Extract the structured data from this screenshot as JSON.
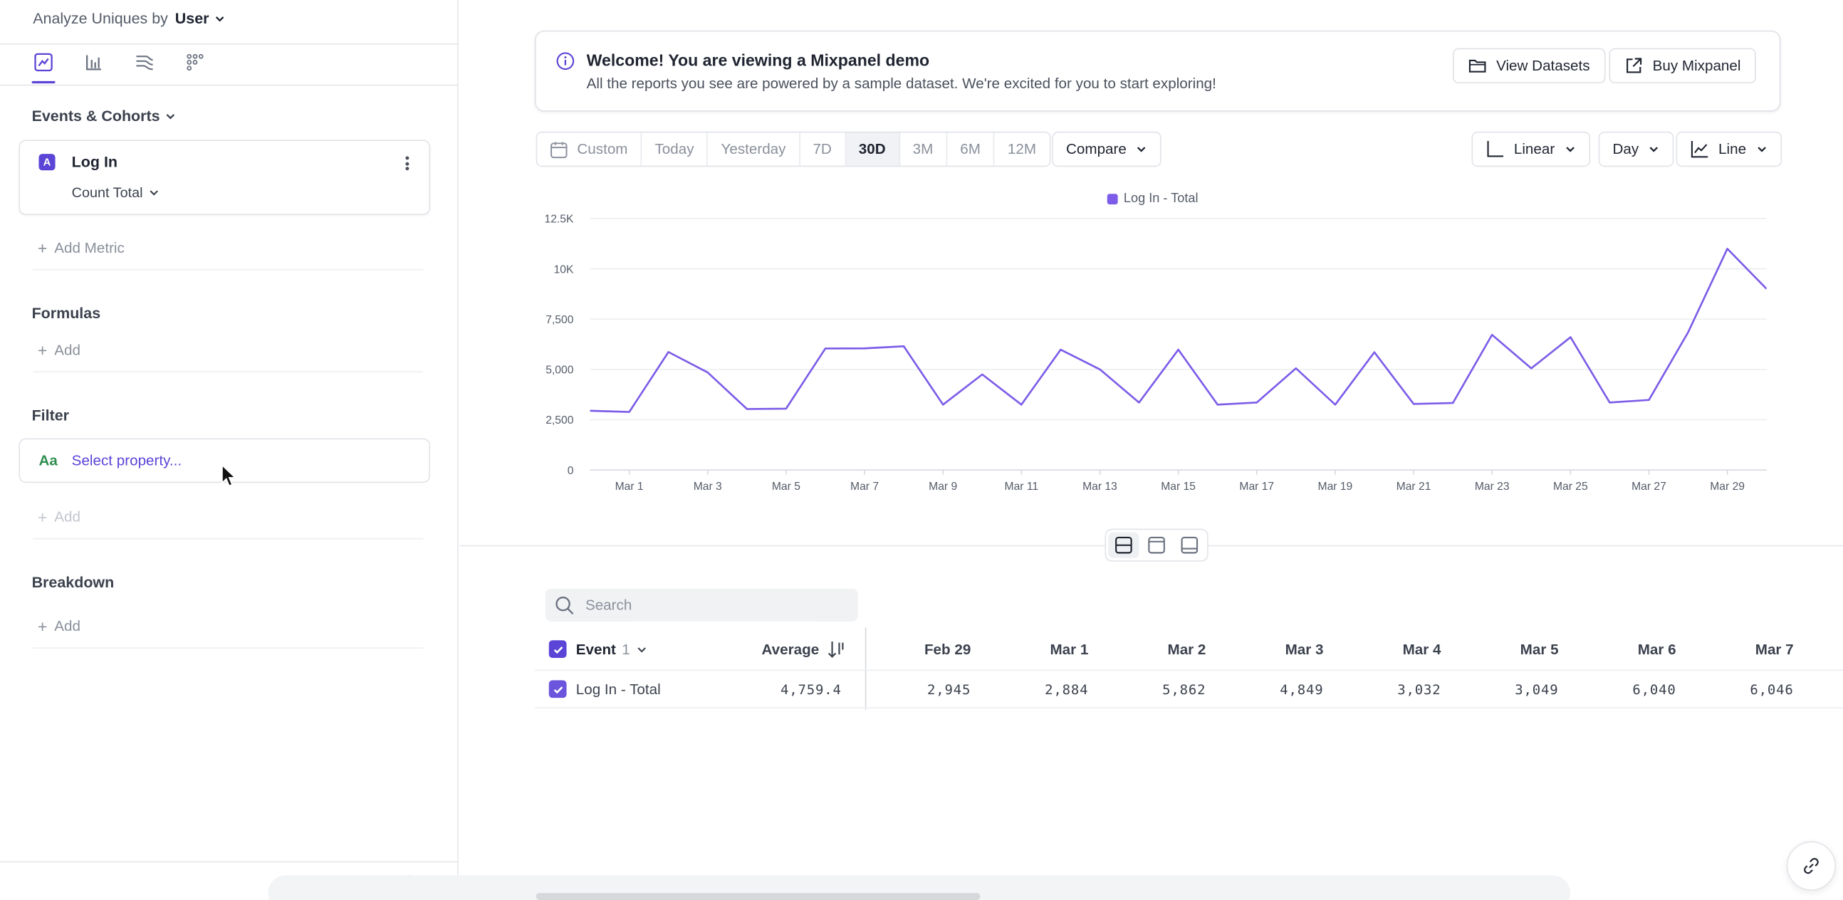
{
  "sidebar": {
    "analyze_label": "Analyze Uniques by",
    "analyze_value": "User",
    "view_tabs": [
      "insights-line-icon",
      "insights-bar-icon",
      "funnels-icon",
      "retention-grid-icon"
    ],
    "events_title": "Events & Cohorts",
    "metric": {
      "letter": "A",
      "name": "Log In",
      "measure": "Count Total"
    },
    "add_metric": "Add Metric",
    "formulas_title": "Formulas",
    "formulas_add": "Add",
    "filter_title": "Filter",
    "filter_type": "Aa",
    "filter_placeholder": "Select property...",
    "filter_add": "Add",
    "breakdown_title": "Breakdown",
    "breakdown_add": "Add"
  },
  "banner": {
    "title": "Welcome! You are viewing a Mixpanel demo",
    "subtitle": "All the reports you see are powered by a sample dataset. We're excited for you to start exploring!",
    "view_datasets": "View Datasets",
    "buy": "Buy Mixpanel"
  },
  "toolbar": {
    "ranges": [
      "Custom",
      "Today",
      "Yesterday",
      "7D",
      "30D",
      "3M",
      "6M",
      "12M"
    ],
    "active_range": "30D",
    "compare": "Compare",
    "scale": "Linear",
    "interval": "Day",
    "chart_type": "Line"
  },
  "chart_data": {
    "type": "line",
    "title": "",
    "xlabel": "",
    "ylabel": "",
    "ylim": [
      0,
      12500
    ],
    "yticks": [
      "0",
      "2,500",
      "5,000",
      "7,500",
      "10K",
      "12.5K"
    ],
    "x": [
      "Feb 29",
      "Mar 1",
      "Mar 2",
      "Mar 3",
      "Mar 4",
      "Mar 5",
      "Mar 6",
      "Mar 7",
      "Mar 8",
      "Mar 9",
      "Mar 10",
      "Mar 11",
      "Mar 12",
      "Mar 13",
      "Mar 14",
      "Mar 15",
      "Mar 16",
      "Mar 17",
      "Mar 18",
      "Mar 19",
      "Mar 20",
      "Mar 21",
      "Mar 22",
      "Mar 23",
      "Mar 24",
      "Mar 25",
      "Mar 26",
      "Mar 27",
      "Mar 28",
      "Mar 29",
      "Mar 30"
    ],
    "xtick_labels": [
      "Mar 1",
      "Mar 3",
      "Mar 5",
      "Mar 7",
      "Mar 9",
      "Mar 11",
      "Mar 13",
      "Mar 15",
      "Mar 17",
      "Mar 19",
      "Mar 21",
      "Mar 23",
      "Mar 25",
      "Mar 27",
      "Mar 29"
    ],
    "series": [
      {
        "name": "Log In - Total",
        "color": "#7c5ce8",
        "values": [
          2945,
          2884,
          5862,
          4849,
          3032,
          3049,
          6040,
          6046,
          6150,
          3250,
          4750,
          3250,
          5980,
          5000,
          3350,
          5980,
          3250,
          3350,
          5050,
          3250,
          5850,
          3280,
          3330,
          6720,
          5050,
          6600,
          3350,
          3480,
          6850,
          11000,
          9000
        ]
      }
    ],
    "legend": "top-center",
    "grid": true
  },
  "table": {
    "search_placeholder": "Search",
    "event_header": "Event",
    "event_count": "1",
    "average_header": "Average",
    "date_headers": [
      "Feb 29",
      "Mar 1",
      "Mar 2",
      "Mar 3",
      "Mar 4",
      "Mar 5",
      "Mar 6",
      "Mar 7"
    ],
    "row": {
      "name": "Log In - Total",
      "average": "4,759.4",
      "values": [
        "2,945",
        "2,884",
        "5,862",
        "4,849",
        "3,032",
        "3,049",
        "6,040",
        "6,046"
      ]
    }
  },
  "colors": {
    "accent": "#5a45d6",
    "line": "#7c5ce8",
    "filter_type": "#2f8f4f"
  }
}
